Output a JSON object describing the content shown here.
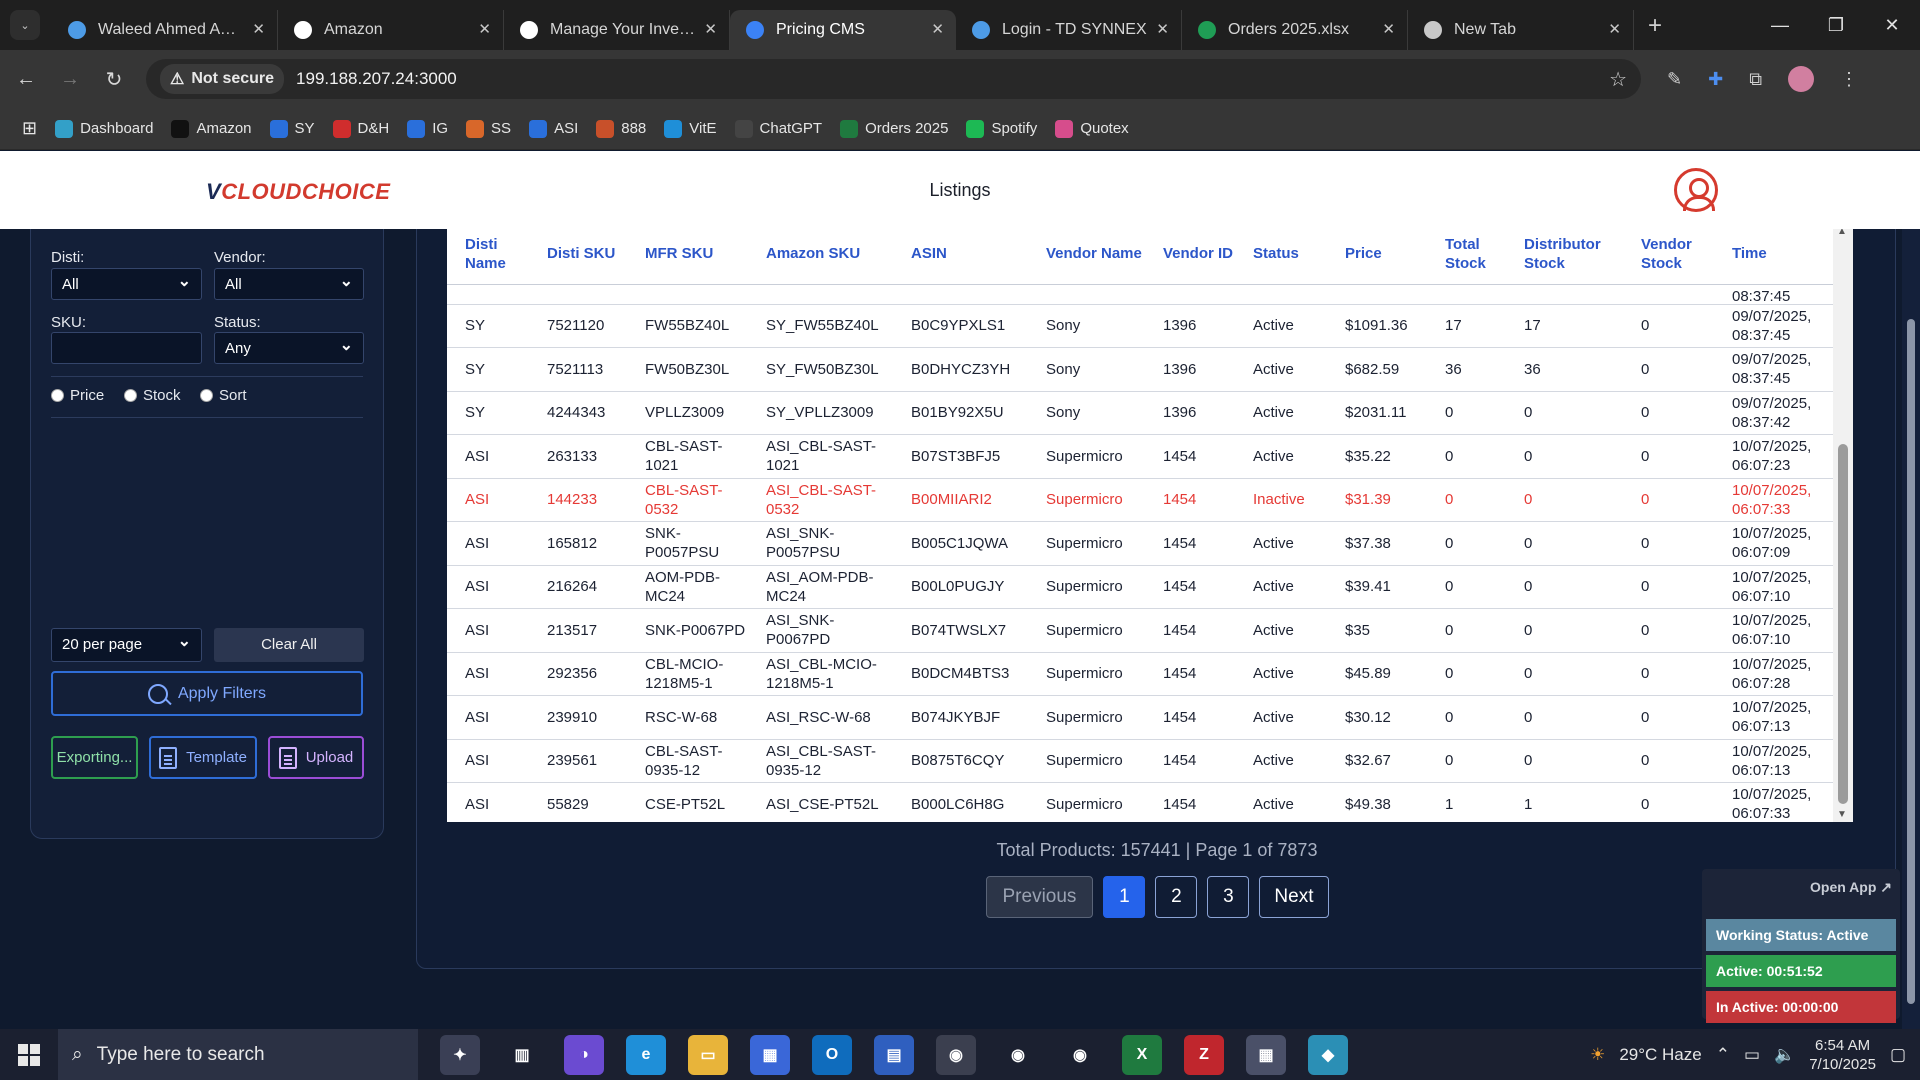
{
  "browser": {
    "tabs": [
      {
        "title": "Waleed Ahmed Awan",
        "favicon_color": "#4d9be6",
        "active": false
      },
      {
        "title": "Amazon",
        "favicon_color": "#ffffff",
        "active": false
      },
      {
        "title": "Manage Your Inventory",
        "favicon_color": "#ffffff",
        "active": false
      },
      {
        "title": "Pricing CMS",
        "favicon_color": "#3b82f6",
        "active": true
      },
      {
        "title": "Login - TD SYNNEX",
        "favicon_color": "#4d9be6",
        "active": false
      },
      {
        "title": "Orders 2025.xlsx",
        "favicon_color": "#1f9d55",
        "active": false
      },
      {
        "title": "New Tab",
        "favicon_color": "#c8c8c8",
        "active": false
      }
    ],
    "security_label": "Not secure",
    "url": "199.188.207.24:3000",
    "bookmarks": [
      "Dashboard",
      "Amazon",
      "SY",
      "D&H",
      "IG",
      "SS",
      "ASI",
      "888",
      "VitE",
      "ChatGPT",
      "Orders 2025",
      "Spotify",
      "Quotex"
    ]
  },
  "header": {
    "logo_v": "V",
    "logo_text": "CLOUDCHOICE",
    "title": "Listings"
  },
  "filters": {
    "disti_label": "Disti:",
    "disti_value": "All",
    "vendor_label": "Vendor:",
    "vendor_value": "All",
    "sku_label": "SKU:",
    "sku_value": "",
    "status_label": "Status:",
    "status_value": "Any",
    "radio_price": "Price",
    "radio_stock": "Stock",
    "radio_sort": "Sort",
    "per_page": "20 per page",
    "clear_all": "Clear All",
    "apply": "Apply Filters",
    "export": "Exporting...",
    "template": "Template",
    "upload": "Upload"
  },
  "table": {
    "columns": [
      "Disti Name",
      "Disti SKU",
      "MFR SKU",
      "Amazon SKU",
      "ASIN",
      "Vendor Name",
      "Vendor ID",
      "Status",
      "Price",
      "Total Stock",
      "Distributor Stock",
      "Vendor Stock",
      "Time"
    ],
    "partial_time": "08:37:45",
    "rows": [
      {
        "disti": "SY",
        "disti_sku": "7521120",
        "mfr_sku": "FW55BZ40L",
        "amazon_sku": "SY_FW55BZ40L",
        "asin": "B0C9YPXLS1",
        "vendor": "Sony",
        "vendor_id": "1396",
        "status": "Active",
        "price": "$1091.36",
        "total": "17",
        "dist": "17",
        "vstock": "0",
        "time": "09/07/2025, 08:37:45"
      },
      {
        "disti": "SY",
        "disti_sku": "7521113",
        "mfr_sku": "FW50BZ30L",
        "amazon_sku": "SY_FW50BZ30L",
        "asin": "B0DHYCZ3YH",
        "vendor": "Sony",
        "vendor_id": "1396",
        "status": "Active",
        "price": "$682.59",
        "total": "36",
        "dist": "36",
        "vstock": "0",
        "time": "09/07/2025, 08:37:45"
      },
      {
        "disti": "SY",
        "disti_sku": "4244343",
        "mfr_sku": "VPLLZ3009",
        "amazon_sku": "SY_VPLLZ3009",
        "asin": "B01BY92X5U",
        "vendor": "Sony",
        "vendor_id": "1396",
        "status": "Active",
        "price": "$2031.11",
        "total": "0",
        "dist": "0",
        "vstock": "0",
        "time": "09/07/2025, 08:37:42"
      },
      {
        "disti": "ASI",
        "disti_sku": "263133",
        "mfr_sku": "CBL-SAST-1021",
        "amazon_sku": "ASI_CBL-SAST-1021",
        "asin": "B07ST3BFJ5",
        "vendor": "Supermicro",
        "vendor_id": "1454",
        "status": "Active",
        "price": "$35.22",
        "total": "0",
        "dist": "0",
        "vstock": "0",
        "time": "10/07/2025, 06:07:23"
      },
      {
        "disti": "ASI",
        "disti_sku": "144233",
        "mfr_sku": "CBL-SAST-0532",
        "amazon_sku": "ASI_CBL-SAST-0532",
        "asin": "B00MIIARI2",
        "vendor": "Supermicro",
        "vendor_id": "1454",
        "status": "Inactive",
        "price": "$31.39",
        "total": "0",
        "dist": "0",
        "vstock": "0",
        "time": "10/07/2025, 06:07:33"
      },
      {
        "disti": "ASI",
        "disti_sku": "165812",
        "mfr_sku": "SNK-P0057PSU",
        "amazon_sku": "ASI_SNK-P0057PSU",
        "asin": "B005C1JQWA",
        "vendor": "Supermicro",
        "vendor_id": "1454",
        "status": "Active",
        "price": "$37.38",
        "total": "0",
        "dist": "0",
        "vstock": "0",
        "time": "10/07/2025, 06:07:09"
      },
      {
        "disti": "ASI",
        "disti_sku": "216264",
        "mfr_sku": "AOM-PDB-MC24",
        "amazon_sku": "ASI_AOM-PDB-MC24",
        "asin": "B00L0PUGJY",
        "vendor": "Supermicro",
        "vendor_id": "1454",
        "status": "Active",
        "price": "$39.41",
        "total": "0",
        "dist": "0",
        "vstock": "0",
        "time": "10/07/2025, 06:07:10"
      },
      {
        "disti": "ASI",
        "disti_sku": "213517",
        "mfr_sku": "SNK-P0067PD",
        "amazon_sku": "ASI_SNK-P0067PD",
        "asin": "B074TWSLX7",
        "vendor": "Supermicro",
        "vendor_id": "1454",
        "status": "Active",
        "price": "$35",
        "total": "0",
        "dist": "0",
        "vstock": "0",
        "time": "10/07/2025, 06:07:10"
      },
      {
        "disti": "ASI",
        "disti_sku": "292356",
        "mfr_sku": "CBL-MCIO-1218M5-1",
        "amazon_sku": "ASI_CBL-MCIO-1218M5-1",
        "asin": "B0DCM4BTS3",
        "vendor": "Supermicro",
        "vendor_id": "1454",
        "status": "Active",
        "price": "$45.89",
        "total": "0",
        "dist": "0",
        "vstock": "0",
        "time": "10/07/2025, 06:07:28"
      },
      {
        "disti": "ASI",
        "disti_sku": "239910",
        "mfr_sku": "RSC-W-68",
        "amazon_sku": "ASI_RSC-W-68",
        "asin": "B074JKYBJF",
        "vendor": "Supermicro",
        "vendor_id": "1454",
        "status": "Active",
        "price": "$30.12",
        "total": "0",
        "dist": "0",
        "vstock": "0",
        "time": "10/07/2025, 06:07:13"
      },
      {
        "disti": "ASI",
        "disti_sku": "239561",
        "mfr_sku": "CBL-SAST-0935-12",
        "amazon_sku": "ASI_CBL-SAST-0935-12",
        "asin": "B0875T6CQY",
        "vendor": "Supermicro",
        "vendor_id": "1454",
        "status": "Active",
        "price": "$32.67",
        "total": "0",
        "dist": "0",
        "vstock": "0",
        "time": "10/07/2025, 06:07:13"
      },
      {
        "disti": "ASI",
        "disti_sku": "55829",
        "mfr_sku": "CSE-PT52L",
        "amazon_sku": "ASI_CSE-PT52L",
        "asin": "B000LC6H8G",
        "vendor": "Supermicro",
        "vendor_id": "1454",
        "status": "Active",
        "price": "$49.38",
        "total": "1",
        "dist": "1",
        "vstock": "0",
        "time": "10/07/2025, 06:07:33"
      }
    ]
  },
  "pagination": {
    "summary": "Total Products: 157441 | Page 1 of 7873",
    "previous": "Previous",
    "pages": [
      "1",
      "2",
      "3"
    ],
    "next": "Next"
  },
  "status_widget": {
    "open_app": "Open App ↗",
    "working": "Working Status: Active",
    "active": "Active: 00:51:52",
    "inactive": "In Active: 00:00:00",
    "colors": {
      "working": "#5a87a0",
      "active": "#2e9e4f",
      "inactive": "#c2363a"
    }
  },
  "taskbar": {
    "search_placeholder": "Type here to search",
    "weather": "29°C  Haze",
    "time": "6:54 AM",
    "date": "7/10/2025"
  }
}
